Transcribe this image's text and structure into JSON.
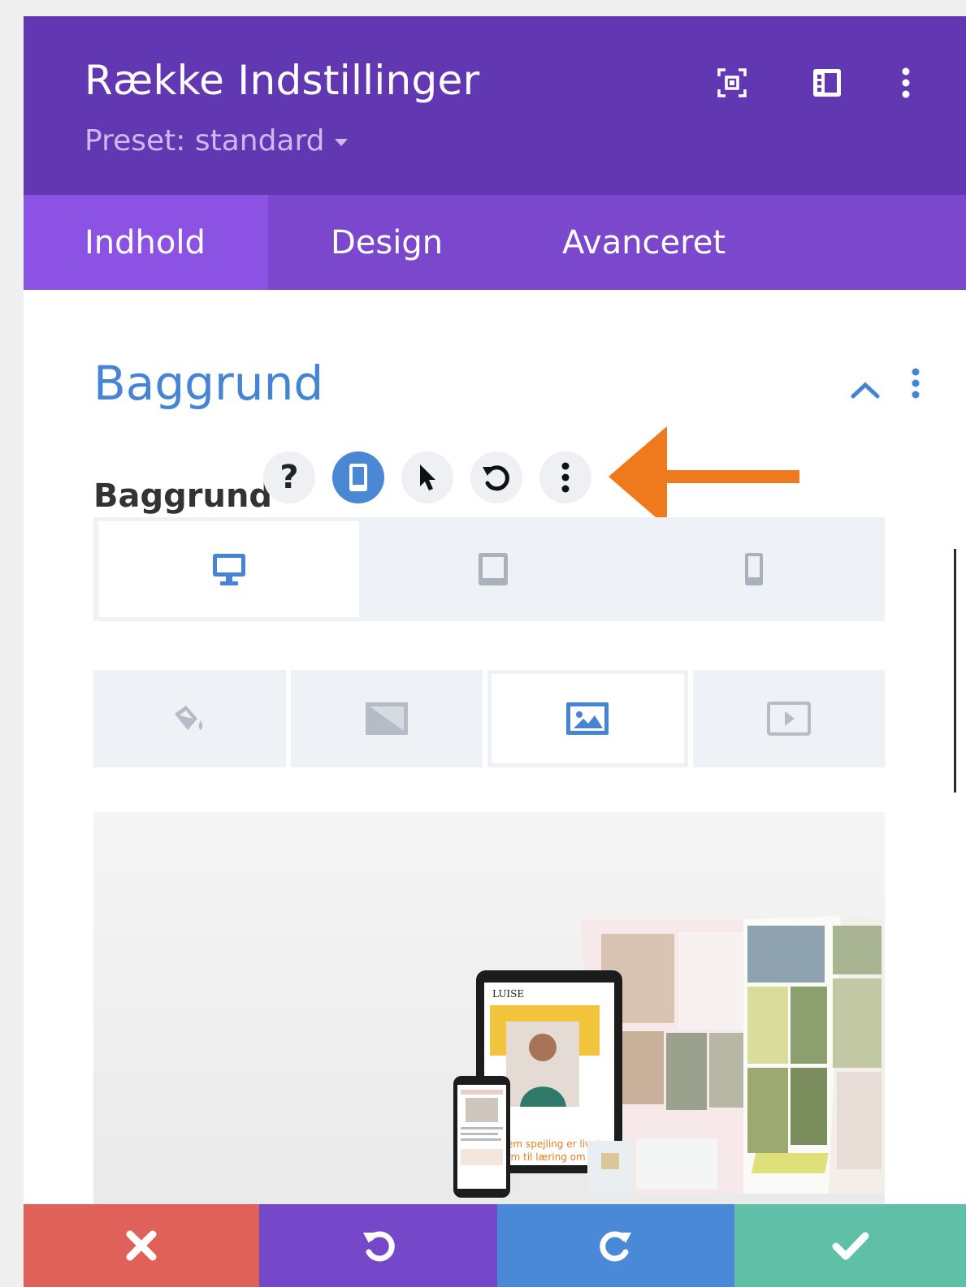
{
  "header": {
    "title": "Række Indstillinger",
    "preset_label": "Preset: standard",
    "icons": [
      "focus-icon",
      "sidebar-layout-icon",
      "more-vertical-icon"
    ]
  },
  "tabs": [
    {
      "label": "Indhold",
      "active": true
    },
    {
      "label": "Design",
      "active": false
    },
    {
      "label": "Avanceret",
      "active": false
    }
  ],
  "section": {
    "title": "Baggrund",
    "expanded": true
  },
  "field": {
    "label": "Baggrund",
    "help_glyph": "?",
    "buttons": [
      "help-icon",
      "responsive-phone-icon",
      "hover-cursor-icon",
      "reset-icon",
      "more-vertical-icon"
    ],
    "active_button": "responsive-phone-icon"
  },
  "device_tabs": [
    {
      "name": "desktop",
      "active": true
    },
    {
      "name": "tablet",
      "active": false
    },
    {
      "name": "phone",
      "active": false
    }
  ],
  "background_type_tabs": [
    {
      "name": "color",
      "active": false
    },
    {
      "name": "gradient",
      "active": false
    },
    {
      "name": "image",
      "active": true
    },
    {
      "name": "video",
      "active": false
    }
  ],
  "preview": {
    "tablet_brand": "LUISE",
    "tablet_caption_line1": "...nem spejling er livet en",
    "tablet_caption_line2": "...orm til læring om"
  },
  "footer": {
    "buttons": [
      "cancel-button",
      "undo-button",
      "redo-button",
      "save-button"
    ]
  },
  "colors": {
    "header_bg": "#6238b2",
    "tabs_bg": "#7b47cc",
    "tab_active_bg": "#8c52e3",
    "accent_blue": "#4584d5",
    "arrow_orange": "#ef7a1e",
    "cancel": "#e0605a",
    "undo": "#7548c9",
    "redo": "#4a89d8",
    "save": "#5fc0a7"
  }
}
